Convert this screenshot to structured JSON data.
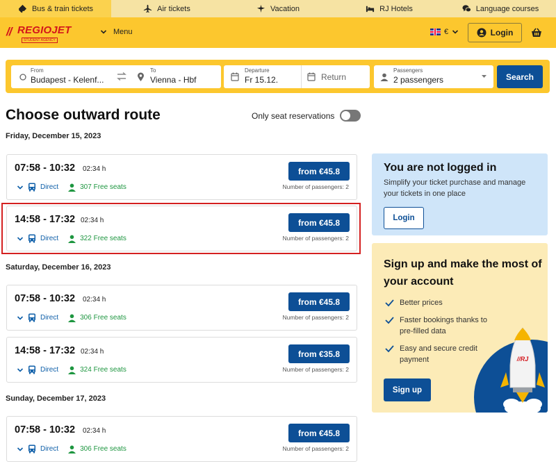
{
  "topbar": {
    "tabs": [
      {
        "label": "Bus & train tickets",
        "icon": "ticket-icon",
        "active": true
      },
      {
        "label": "Air tickets",
        "icon": "plane-icon",
        "active": false
      },
      {
        "label": "Vacation",
        "icon": "palm-plane-icon",
        "active": false
      },
      {
        "label": "RJ Hotels",
        "icon": "bed-icon",
        "active": false
      },
      {
        "label": "Language courses",
        "icon": "chat-bubbles-icon",
        "active": false
      }
    ]
  },
  "header": {
    "logo_text": "REGIOJET",
    "logo_sub": "STUDENT AGENCY",
    "menu_label": "Menu",
    "currency": "€",
    "login_label": "Login"
  },
  "search": {
    "from_label": "From",
    "from_value": "Budapest - Kelenf...",
    "to_label": "To",
    "to_value": "Vienna - Hbf",
    "departure_label": "Departure",
    "departure_value": "Fr 15.12.",
    "return_placeholder": "Return",
    "passengers_label": "Passengers",
    "passengers_value": "2 passengers",
    "search_label": "Search"
  },
  "main": {
    "title": "Choose outward route",
    "toggle_label": "Only seat reservations",
    "days": [
      {
        "date": "Friday, December 15, 2023",
        "routes": [
          {
            "times": "07:58 - 10:32",
            "duration": "02:34 h",
            "direct": "Direct",
            "seats": "307 Free seats",
            "price": "from €45.8",
            "pax": "Number of passengers: 2"
          },
          {
            "times": "14:58 - 17:32",
            "duration": "02:34 h",
            "direct": "Direct",
            "seats": "322 Free seats",
            "price": "from €45.8",
            "pax": "Number of passengers: 2"
          }
        ]
      },
      {
        "date": "Saturday, December 16, 2023",
        "routes": [
          {
            "times": "07:58 - 10:32",
            "duration": "02:34 h",
            "direct": "Direct",
            "seats": "306 Free seats",
            "price": "from €45.8",
            "pax": "Number of passengers: 2"
          },
          {
            "times": "14:58 - 17:32",
            "duration": "02:34 h",
            "direct": "Direct",
            "seats": "324 Free seats",
            "price": "from €35.8",
            "pax": "Number of passengers: 2"
          }
        ]
      },
      {
        "date": "Sunday, December 17, 2023",
        "routes": [
          {
            "times": "07:58 - 10:32",
            "duration": "02:34 h",
            "direct": "Direct",
            "seats": "306 Free seats",
            "price": "from €45.8",
            "pax": "Number of passengers: 2"
          }
        ]
      }
    ]
  },
  "sidebar": {
    "login_panel": {
      "title": "You are not logged in",
      "text": "Simplify your ticket purchase and manage your tickets in one place",
      "button": "Login"
    },
    "signup_panel": {
      "title": "Sign up and make the most of your account",
      "benefits": [
        "Better prices",
        "Faster bookings thanks to pre-filled data",
        "Easy and secure credit payment"
      ],
      "button": "Sign up",
      "rocket_text": "//RJ"
    }
  },
  "colors": {
    "brand_yellow": "#fcc72e",
    "brand_blue": "#0d4f96",
    "brand_red": "#d3151b",
    "seat_green": "#1e9640",
    "highlight_red": "#d42020"
  }
}
